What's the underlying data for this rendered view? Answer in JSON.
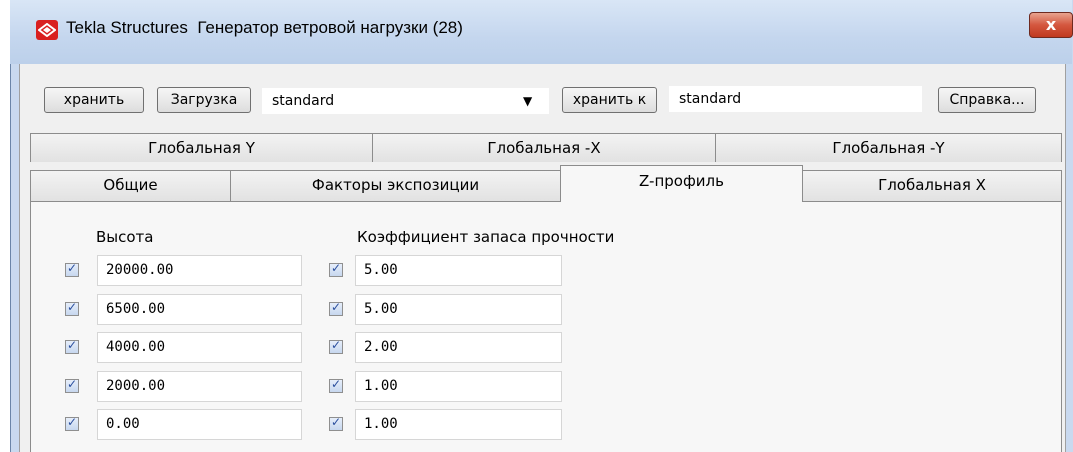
{
  "window": {
    "app_name": "Tekla Structures",
    "title": "Генератор ветровой нагрузки (28)",
    "close_symbol": "x"
  },
  "toolbar": {
    "save_label": "хранить",
    "load_label": "Загрузка",
    "preset_value": "standard",
    "combo_arrow": "▼",
    "save_as_label": "хранить к",
    "save_as_value": "standard",
    "help_label": "Справка..."
  },
  "tabs": {
    "row_back": [
      "Глобальная Y",
      "Глобальная -X",
      "Глобальная -Y"
    ],
    "row_front": [
      "Общие",
      "Факторы экспозиции",
      "Z-профиль",
      "Глобальная X"
    ],
    "active": "Z-профиль"
  },
  "zprofile": {
    "height_header": "Высота",
    "factor_header": "Коэффициент запаса прочности",
    "check_symbol": "✓",
    "rows": [
      {
        "height": "20000.00",
        "factor": "5.00",
        "height_checked": true,
        "factor_checked": true
      },
      {
        "height": "6500.00",
        "factor": "5.00",
        "height_checked": true,
        "factor_checked": true
      },
      {
        "height": "4000.00",
        "factor": "2.00",
        "height_checked": true,
        "factor_checked": true
      },
      {
        "height": "2000.00",
        "factor": "1.00",
        "height_checked": true,
        "factor_checked": true
      },
      {
        "height": "0.00",
        "factor": "1.00",
        "height_checked": true,
        "factor_checked": true
      }
    ]
  },
  "colors": {
    "titlebar": "#c4d6ee",
    "close_button": "#c0391f",
    "client": "#f0f0f0"
  }
}
